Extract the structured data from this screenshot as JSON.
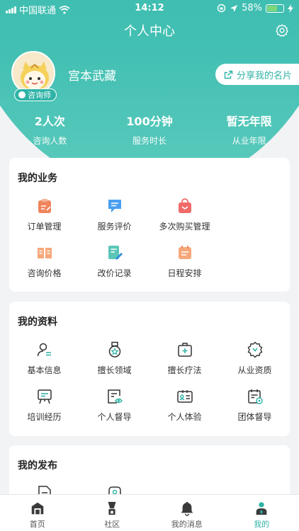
{
  "status_bar": {
    "carrier": "中国联通",
    "time": "14:12",
    "battery": "58%",
    "battery_level": 0.58
  },
  "header": {
    "title": "个人中心"
  },
  "profile": {
    "name": "宫本武藏",
    "badge": "咨询师",
    "share_label": "分享我的名片"
  },
  "stats": [
    {
      "value": "2人次",
      "label": "咨询人数"
    },
    {
      "value": "100分钟",
      "label": "服务时长"
    },
    {
      "value": "暂无年限",
      "label": "从业年限"
    }
  ],
  "business": {
    "title": "我的业务",
    "items": [
      {
        "label": "订单管理",
        "icon": "order-clipboard-icon"
      },
      {
        "label": "服务评价",
        "icon": "chat-review-icon"
      },
      {
        "label": "多次购买管理",
        "icon": "shopping-bag-icon"
      },
      {
        "label": "咨询价格",
        "icon": "price-book-icon"
      },
      {
        "label": "改价记录",
        "icon": "edit-record-icon"
      },
      {
        "label": "日程安排",
        "icon": "calendar-icon"
      }
    ]
  },
  "profile_info": {
    "title": "我的资料",
    "items": [
      {
        "label": "基本信息",
        "icon": "user-info-icon"
      },
      {
        "label": "擅长领域",
        "icon": "medal-icon"
      },
      {
        "label": "擅长疗法",
        "icon": "medical-kit-icon"
      },
      {
        "label": "从业资质",
        "icon": "certificate-icon"
      },
      {
        "label": "培训经历",
        "icon": "training-board-icon"
      },
      {
        "label": "个人督导",
        "icon": "personal-supervision-icon"
      },
      {
        "label": "个人体验",
        "icon": "id-card-icon"
      },
      {
        "label": "团体督导",
        "icon": "group-supervision-icon"
      }
    ]
  },
  "publish": {
    "title": "我的发布"
  },
  "tabs": [
    {
      "label": "首页",
      "icon": "home-icon"
    },
    {
      "label": "社区",
      "icon": "community-icon"
    },
    {
      "label": "我的消息",
      "icon": "bell-icon"
    },
    {
      "label": "我的",
      "icon": "profile-icon",
      "active": true
    }
  ],
  "colors": {
    "primary": "#2fb3a6",
    "orange": "#f0845c",
    "blue": "#4a9ff0",
    "red": "#f06a6a",
    "peach": "#f6a87a",
    "ink": "#333333"
  }
}
